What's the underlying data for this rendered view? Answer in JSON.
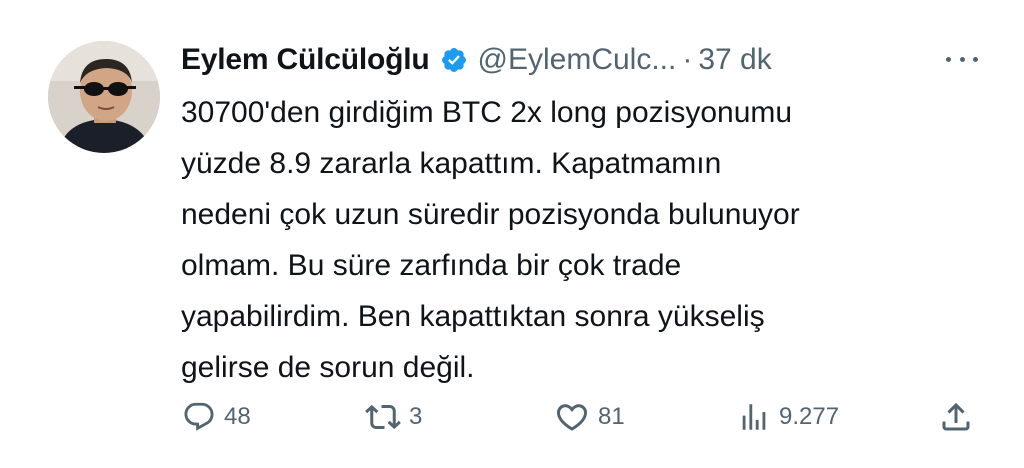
{
  "tweet": {
    "author_name": "Eylem Cülcüloğlu",
    "handle": "@EylemCulc...",
    "separator": "·",
    "time": "37 dk",
    "text_lines": [
      "30700'den girdiğim BTC 2x long pozisyonumu",
      "yüzde 8.9 zararla kapattım. Kapatmamın",
      "nedeni çok uzun süredir pozisyonda bulunuyor",
      "olmam. Bu süre zarfında bir çok trade",
      "yapabilirdim. Ben kapattıktan sonra yükseliş",
      "gelirse de sorun değil."
    ]
  },
  "actions": {
    "reply_count": "48",
    "retweet_count": "3",
    "like_count": "81",
    "views_count": "9.277"
  },
  "icons": {
    "verified": "verified-badge-icon",
    "more": "more-dots-icon",
    "reply": "reply-icon",
    "retweet": "retweet-icon",
    "like": "heart-icon",
    "views": "views-chart-icon",
    "share": "share-icon"
  },
  "colors": {
    "verified_blue": "#1d9bf0",
    "text": "#0f1419",
    "secondary": "#536471"
  }
}
